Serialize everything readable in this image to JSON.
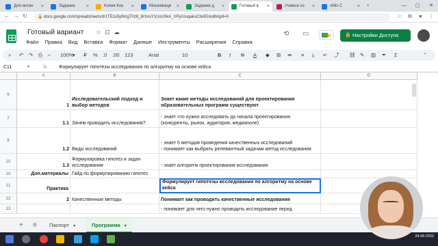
{
  "browser": {
    "tabs": [
      {
        "label": "Для интен",
        "color": "#1a73e8"
      },
      {
        "label": "Задание ",
        "color": "#1a73e8"
      },
      {
        "label": "Копия Кон",
        "color": "#f9ab00"
      },
      {
        "label": "Московище",
        "color": "#1a73e8"
      },
      {
        "label": "Задание д",
        "color": "#0f9d58"
      },
      {
        "label": "Готовый в",
        "color": "#0f9d58",
        "active": true
      },
      {
        "label": "Учимся со",
        "color": "#c2185b"
      },
      {
        "label": "vMix С",
        "color": "#1a73e8"
      }
    ],
    "url": "docs.google.com/spreadsheets/d/1TEzx5y9mgT0z8_8rXxsY1UxU0kA_VPyUruqakuCbAEI/edit#gid=0"
  },
  "sheets": {
    "title": "Готовый вариант",
    "menu": [
      "Файл",
      "Правка",
      "Вид",
      "Вставка",
      "Формат",
      "Данные",
      "Инструменты",
      "Расширения",
      "Справка"
    ],
    "share_label": "Настройки Доступа"
  },
  "toolbar": {
    "zoom": "100%",
    "currency": "₽",
    "percent": "%",
    "decimals": ".0",
    "decimals2": ".00",
    "format": "123",
    "font": "Arial",
    "font_size": "10",
    "bold": "B",
    "italic": "I",
    "strike": "S",
    "color": "A"
  },
  "formula_bar": {
    "cell_ref": "C11",
    "fx": "fx",
    "content": "Формулирует гипотезы исследования по алгоритму на основе кейса"
  },
  "grid": {
    "columns": [
      "A",
      "B",
      "C",
      "D"
    ],
    "rows": [
      {
        "num": "6",
        "a": "",
        "b_num": "1",
        "b": "Исследовательский подход и выбор методов",
        "c": "Знает какие методы исследований для проектирования образовательных программ существуют",
        "bold": true
      },
      {
        "num": "7",
        "a": "",
        "b_num": "1.1",
        "b": "Зачем проводить исследования?",
        "c": "- знает что нужно исследовать до начала проектирования (конкуренты, рынок, аудитория, медиаполе)"
      },
      {
        "num": "8",
        "a": "",
        "b_num": "1.2",
        "b": "Виды исследований",
        "c": "- знает 5 методов проведения качественных исследований\n- понимает как выбрать релевантный задачам метод исследования"
      },
      {
        "num": "10",
        "a": "",
        "b_num": "1.3",
        "b": "Формулировка гипотез и задач исследования",
        "c": "- знает алгоритм проектирования исследования"
      },
      {
        "num": "10",
        "a": "Доп.материалы",
        "b_num": "",
        "b": "Гайд по формулированию гипотез",
        "c": ""
      },
      {
        "num": "11",
        "a": "Практика",
        "b_num": "",
        "b": "",
        "c": "Формулирует гипотезы исследования по алгоритму на основе кейса"
      },
      {
        "num": "12",
        "a": "",
        "b_num": "2",
        "b": "Качественные методы",
        "c": "Понимает как проводить качественные исследования"
      },
      {
        "num": "13",
        "a": "",
        "b_num": "",
        "b": "",
        "c": "- понимает для чего нужно проводить исследование перед"
      }
    ]
  },
  "sheet_tabs": {
    "add": "+",
    "list": "≡",
    "tabs": [
      "Паспорт",
      "Программа"
    ],
    "active": "Программа"
  },
  "taskbar": {
    "time": "",
    "date": "24.09.2022"
  }
}
